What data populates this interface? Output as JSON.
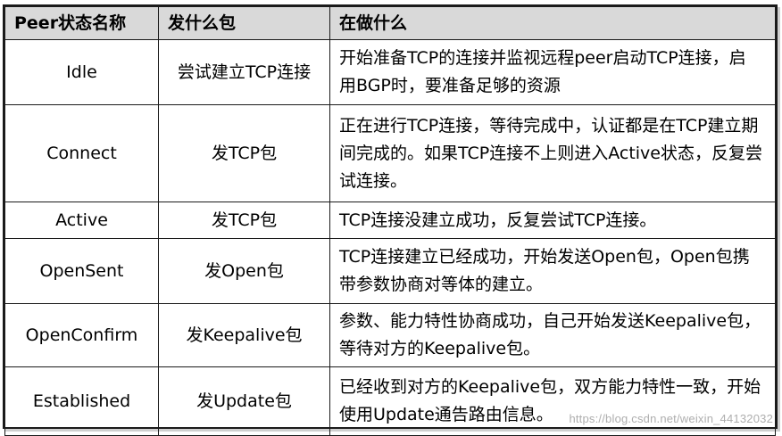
{
  "table": {
    "headers": [
      "Peer状态名称",
      "发什么包",
      "在做什么"
    ],
    "rows": [
      {
        "state": "Idle",
        "packet": "尝试建立TCP连接",
        "desc": "开始准备TCP的连接并监视远程peer启动TCP连接，启用BGP时，要准备足够的资源"
      },
      {
        "state": "Connect",
        "packet": "发TCP包",
        "desc": "正在进行TCP连接，等待完成中，认证都是在TCP建立期间完成的。如果TCP连接不上则进入Active状态，反复尝试连接。"
      },
      {
        "state": "Active",
        "packet": "发TCP包",
        "desc": "TCP连接没建立成功，反复尝试TCP连接。"
      },
      {
        "state": "OpenSent",
        "packet": "发Open包",
        "desc": "TCP连接建立已经成功，开始发送Open包，Open包携带参数协商对等体的建立。"
      },
      {
        "state": "OpenConfirm",
        "packet": "发Keepalive包",
        "desc": "参数、能力特性协商成功，自己开始发送Keepalive包，等待对方的Keepalive包。"
      },
      {
        "state": "Established",
        "packet": "发Update包",
        "desc": "已经收到对方的Keepalive包，双方能力特性一致，开始使用Update通告路由信息。"
      }
    ]
  },
  "watermark": "https://blog.csdn.net/weixin_44132032"
}
